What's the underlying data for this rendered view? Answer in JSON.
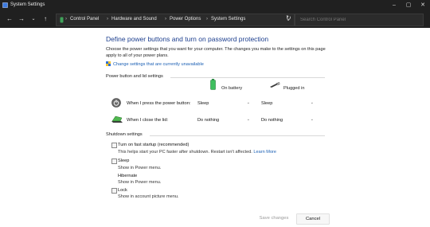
{
  "window": {
    "title": "System Settings"
  },
  "nav": {
    "breadcrumb": [
      "Control Panel",
      "Hardware and Sound",
      "Power Options",
      "System Settings"
    ],
    "search_placeholder": "Search Control Panel"
  },
  "main": {
    "heading": "Define power buttons and turn on password protection",
    "intro": "Choose the power settings that you want for your computer. The changes you make to the settings on this page apply to all of your power plans.",
    "change_link": "Change settings that are currently unavailable"
  },
  "power_section": {
    "title": "Power button and lid settings",
    "columns": {
      "battery": "On battery",
      "plugged": "Plugged in"
    },
    "rows": [
      {
        "label": "When I press the power button:",
        "battery": "Sleep",
        "plugged": "Sleep"
      },
      {
        "label": "When I close the lid:",
        "battery": "Do nothing",
        "plugged": "Do nothing"
      }
    ]
  },
  "shutdown_section": {
    "title": "Shutdown settings",
    "items": [
      {
        "label": "Turn on fast startup (recommended)",
        "desc": "This helps start your PC faster after shutdown. Restart isn't affected.",
        "link": "Learn More"
      },
      {
        "label": "Sleep",
        "desc": "Show in Power menu."
      },
      {
        "label": "Hibernate",
        "desc": "Show in Power menu."
      },
      {
        "label": "Lock",
        "desc": "Show in account picture menu."
      }
    ]
  },
  "footer": {
    "save": "Save changes",
    "cancel": "Cancel"
  },
  "colors": {
    "heading": "#1c3e8e",
    "link": "#1a5fb4",
    "titlebar": "#202020"
  }
}
